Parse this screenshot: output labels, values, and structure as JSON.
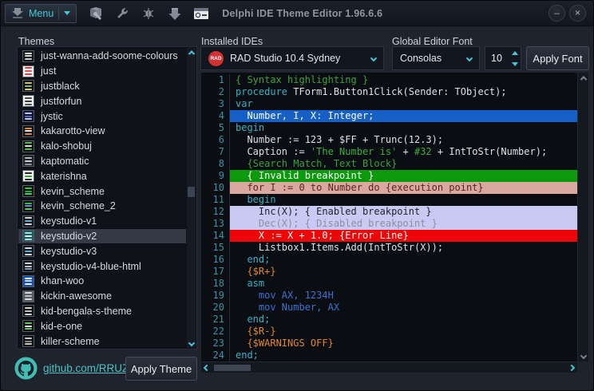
{
  "colors": {
    "accent": "#44c7d6",
    "link": "#4cc3c0",
    "badge-red": "#d43232"
  },
  "titlebar": {
    "menu_label": "Menu",
    "title": "Delphi IDE Theme Editor 1.96.6.6",
    "toolbar_icons": [
      "install-package-icon",
      "wrench-icon",
      "bug-icon",
      "download-icon",
      "console-window-icon"
    ],
    "minimize_glyph": "–",
    "close_glyph": "×"
  },
  "themes_panel": {
    "label": "Themes",
    "items": [
      {
        "name": "just-wanna-add-soome-colours",
        "selected": false,
        "icon": {
          "bg": "#14161a",
          "stripes": [
            "#e8e8e8",
            "#d8d8d8",
            "#c8c8c8"
          ]
        }
      },
      {
        "name": "just",
        "selected": false,
        "icon": {
          "bg": "#f2f2f2",
          "stripes": [
            "#d84040",
            "#e05858",
            "#d84040"
          ]
        }
      },
      {
        "name": "justblack",
        "selected": false,
        "icon": {
          "bg": "#101010",
          "stripes": [
            "#c8c860",
            "#88b868",
            "#d0d070"
          ]
        }
      },
      {
        "name": "justforfun",
        "selected": false,
        "icon": {
          "bg": "#f0f0f0",
          "stripes": [
            "#484848",
            "#383838",
            "#505050"
          ]
        }
      },
      {
        "name": "jystic",
        "selected": false,
        "icon": {
          "bg": "#101634",
          "stripes": [
            "#c0c8e0",
            "#5868c0",
            "#c0c8e0"
          ]
        }
      },
      {
        "name": "kakarotto-view",
        "selected": false,
        "icon": {
          "bg": "#101010",
          "stripes": [
            "#e08830",
            "#e8e8e8",
            "#e08830"
          ]
        }
      },
      {
        "name": "kalo-shobuj",
        "selected": false,
        "icon": {
          "bg": "#0c120c",
          "stripes": [
            "#58b858",
            "#c8e8c8",
            "#58b858"
          ]
        }
      },
      {
        "name": "kaptomatic",
        "selected": false,
        "icon": {
          "bg": "#202226",
          "stripes": [
            "#b0b4bc",
            "#d0d4d8",
            "#909498"
          ]
        }
      },
      {
        "name": "katerishna",
        "selected": false,
        "icon": {
          "bg": "#f0f0f0",
          "stripes": [
            "#282828",
            "#30a030",
            "#282828"
          ]
        }
      },
      {
        "name": "kevin_scheme",
        "selected": false,
        "icon": {
          "bg": "#0c100c",
          "stripes": [
            "#38c048",
            "#28a838",
            "#48d058"
          ]
        }
      },
      {
        "name": "kevin_scheme_2",
        "selected": false,
        "icon": {
          "bg": "#0c100c",
          "stripes": [
            "#38c048",
            "#6888e8",
            "#48d058"
          ]
        }
      },
      {
        "name": "keystudio-v1",
        "selected": false,
        "icon": {
          "bg": "#14181e",
          "stripes": [
            "#d0d4d8",
            "#58b8c8",
            "#d0d4d8"
          ]
        }
      },
      {
        "name": "keystudio-v2",
        "selected": true,
        "icon": {
          "bg": "#1e5a60",
          "stripes": [
            "#a8e0e0",
            "#d8f0f0",
            "#a8e0e0"
          ]
        }
      },
      {
        "name": "keystudio-v3",
        "selected": false,
        "icon": {
          "bg": "#14181e",
          "stripes": [
            "#d0d4d8",
            "#58b8c8",
            "#d0d4d8"
          ]
        }
      },
      {
        "name": "keystudio-v4-blue-html",
        "selected": false,
        "icon": {
          "bg": "#14181e",
          "stripes": [
            "#d0d4d8",
            "#c0c4c8",
            "#8898b0"
          ]
        }
      },
      {
        "name": "khan-woo",
        "selected": false,
        "icon": {
          "bg": "#1850a8",
          "stripes": [
            "#e8ecf4",
            "#c8d0e8",
            "#e8ecf4"
          ]
        }
      },
      {
        "name": "kickin-awesome",
        "selected": false,
        "icon": {
          "bg": "#585c60",
          "stripes": [
            "#d8dce0",
            "#b8bcc0",
            "#d8dce0"
          ]
        }
      },
      {
        "name": "kid-bengala-s-theme",
        "selected": false,
        "icon": {
          "bg": "#101014",
          "stripes": [
            "#d0d0d0",
            "#c0c0c0",
            "#d0d0d0"
          ]
        }
      },
      {
        "name": "kid-e-one",
        "selected": false,
        "icon": {
          "bg": "#0c100c",
          "stripes": [
            "#60c860",
            "#e8e8e8",
            "#60c860"
          ]
        }
      },
      {
        "name": "killer-scheme",
        "selected": false,
        "icon": {
          "bg": "#101014",
          "stripes": [
            "#c8c8c8",
            "#888888",
            "#c8c8c8"
          ]
        }
      }
    ]
  },
  "footer": {
    "github_link": "github.com/RRUZ",
    "apply_theme_label": "Apply Theme"
  },
  "ide_panel": {
    "label": "Installed IDEs",
    "selected_ide": "RAD Studio 10.4 Sydney",
    "badge": "RAD"
  },
  "font_panel": {
    "label": "Global Editor Font",
    "font_name": "Consolas",
    "font_size": "10",
    "apply_label": "Apply Font"
  },
  "editor": {
    "palette": {
      "plain": "#dde1e6",
      "kw": "#38b2c4",
      "comment": "#3da13d",
      "string": "#3fae3f",
      "directive": "#e2862c",
      "asm": "#3a72d4",
      "white": "#ffffff",
      "exec_text": "#5b241d",
      "bp_text": "#1f232b",
      "bp_dim": "#8b91a0",
      "linenum": "#3b93a4",
      "editor_bg": "#0a0d12",
      "sel_bg": "#1560c6",
      "invalid_bg": "#0c9a0c",
      "exec_bg": "#d9a89e",
      "bp_bg": "#c9c9f3",
      "error_bg": "#ee0505"
    },
    "lines": [
      {
        "n": 1,
        "bg": "",
        "seg": [
          [
            "c",
            "{ Syntax highlighting }"
          ]
        ]
      },
      {
        "n": 2,
        "bg": "",
        "seg": [
          [
            "k",
            "procedure"
          ],
          [
            "p",
            " TForm1.Button1Click(Sender: TObject);"
          ]
        ]
      },
      {
        "n": 3,
        "bg": "",
        "seg": [
          [
            "k",
            "var"
          ]
        ]
      },
      {
        "n": 4,
        "bg": "sel",
        "seg": [
          [
            "w",
            "  Number, I, X: Integer;"
          ]
        ]
      },
      {
        "n": 5,
        "bg": "",
        "seg": [
          [
            "k",
            "begin"
          ]
        ]
      },
      {
        "n": 6,
        "bg": "",
        "seg": [
          [
            "p",
            "  Number := 123 + $FF + Trunc(12.3);"
          ]
        ]
      },
      {
        "n": 7,
        "bg": "",
        "seg": [
          [
            "p",
            "  Caption := "
          ],
          [
            "s",
            "'The Number is'"
          ],
          [
            "p",
            " + "
          ],
          [
            "s",
            "#32"
          ],
          [
            "p",
            " + IntToStr(Number);"
          ]
        ]
      },
      {
        "n": 8,
        "bg": "",
        "seg": [
          [
            "c",
            "  {Search Match, Text Block}"
          ]
        ]
      },
      {
        "n": 9,
        "bg": "inv",
        "seg": [
          [
            "w",
            "  { Invalid breakpoint }"
          ]
        ]
      },
      {
        "n": 10,
        "bg": "exec",
        "seg": [
          [
            "x",
            "  for I := 0 to Number do {execution point}"
          ]
        ]
      },
      {
        "n": 11,
        "bg": "",
        "seg": [
          [
            "p",
            "  "
          ],
          [
            "k",
            "begin"
          ]
        ]
      },
      {
        "n": 12,
        "bg": "bp",
        "seg": [
          [
            "b",
            "    Inc(X); { Enabled breakpoint }"
          ]
        ]
      },
      {
        "n": 13,
        "bg": "bp",
        "seg": [
          [
            "bd",
            "    Dec(X); { Disabled breakpoint }"
          ]
        ]
      },
      {
        "n": 14,
        "bg": "err",
        "seg": [
          [
            "w",
            "    X := X + 1.0; {Error Line}"
          ]
        ]
      },
      {
        "n": 15,
        "bg": "",
        "seg": [
          [
            "p",
            "    Listbox1.Items.Add(IntToStr(X));"
          ]
        ]
      },
      {
        "n": 16,
        "bg": "",
        "seg": [
          [
            "p",
            "  "
          ],
          [
            "k",
            "end;"
          ]
        ]
      },
      {
        "n": 17,
        "bg": "",
        "seg": [
          [
            "d",
            "  {$R+}"
          ]
        ]
      },
      {
        "n": 18,
        "bg": "",
        "seg": [
          [
            "p",
            "  "
          ],
          [
            "k",
            "asm"
          ]
        ]
      },
      {
        "n": 19,
        "bg": "",
        "seg": [
          [
            "a",
            "    mov AX, 1234H"
          ]
        ]
      },
      {
        "n": 20,
        "bg": "",
        "seg": [
          [
            "a",
            "    mov Number, AX"
          ]
        ]
      },
      {
        "n": 21,
        "bg": "",
        "seg": [
          [
            "p",
            "  "
          ],
          [
            "k",
            "end;"
          ]
        ]
      },
      {
        "n": 22,
        "bg": "",
        "seg": [
          [
            "d",
            "  {$R-}"
          ]
        ]
      },
      {
        "n": 23,
        "bg": "",
        "seg": [
          [
            "d",
            "  {$WARNINGS OFF}"
          ]
        ]
      },
      {
        "n": 24,
        "bg": "",
        "seg": [
          [
            "k",
            "end;"
          ]
        ]
      }
    ]
  }
}
